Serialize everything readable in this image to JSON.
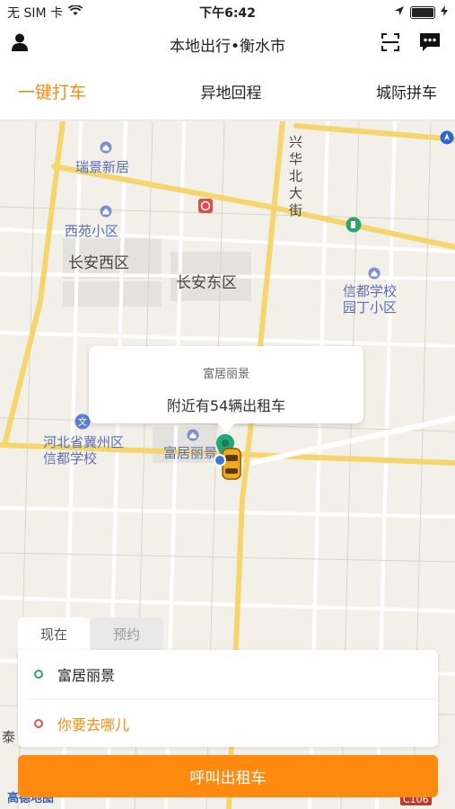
{
  "status": {
    "carrier": "无 SIM 卡",
    "time": "下午6:42"
  },
  "header": {
    "title": "本地出行•衡水市"
  },
  "tabs": [
    {
      "label": "一键打车",
      "active": true
    },
    {
      "label": "异地回程",
      "active": false
    },
    {
      "label": "城际拼车",
      "active": false
    }
  ],
  "map": {
    "pois": [
      "瑞景新居",
      "西苑小区",
      "信都学校园丁小区",
      "河北省冀州区信都学校",
      "富居丽景"
    ],
    "areas": [
      "长安西区",
      "长安东区"
    ],
    "streets": [
      "兴华北大街"
    ],
    "edge_labels": [
      "泰",
      "C106",
      "高德地图"
    ]
  },
  "callout": {
    "title": "富居丽景",
    "subtitle": "附近有54辆出租车"
  },
  "time_tabs": [
    "现在",
    "预约"
  ],
  "locations": {
    "pickup": "富居丽景",
    "destination_placeholder": "你要去哪儿"
  },
  "colors": {
    "accent": "#ff8a10",
    "pickup_dot": "#2ea46a",
    "dest_dot": "#e0504e"
  },
  "call_button": "呼叫出租车"
}
